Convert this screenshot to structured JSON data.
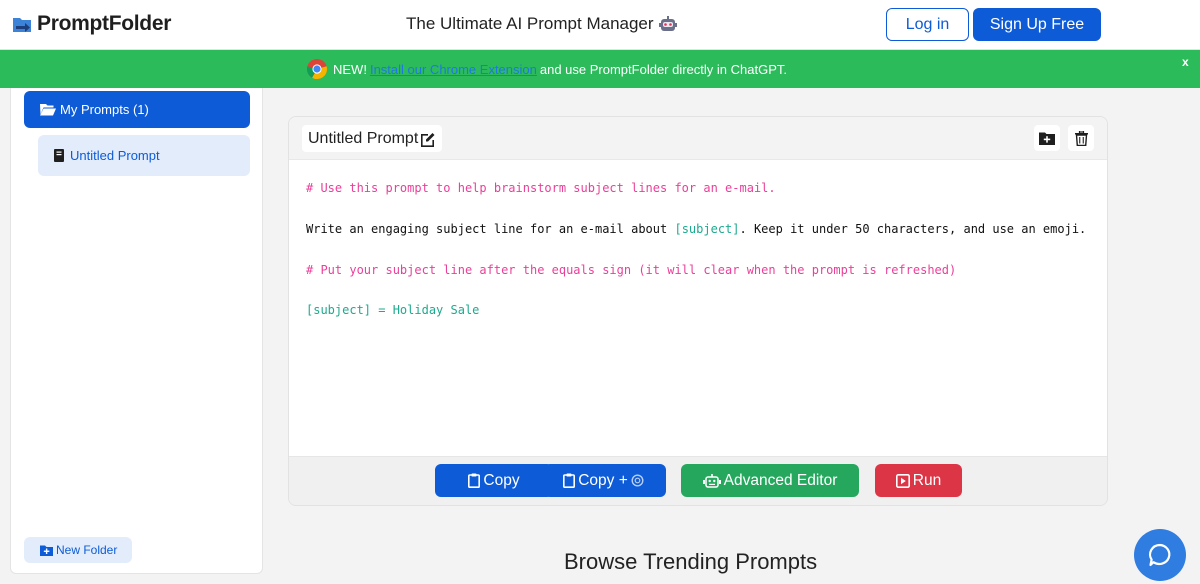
{
  "header": {
    "logo_text": "PromptFolder",
    "tagline": "The Ultimate AI Prompt Manager",
    "login_label": "Log in",
    "signup_label": "Sign Up Free"
  },
  "banner": {
    "new_label": "NEW!",
    "link_text": "Install our Chrome Extension",
    "rest_text": "and use PromptFolder directly in ChatGPT.",
    "close_label": "x"
  },
  "sidebar": {
    "folder_label": "My Prompts (1)",
    "prompt_label": "Untitled Prompt",
    "new_folder_label": "New Folder"
  },
  "prompt": {
    "title": "Untitled Prompt",
    "lines": {
      "l1": "# Use this prompt to help brainstorm subject lines for an e-mail.",
      "l2_a": "Write an engaging subject line for an e-mail about ",
      "l2_var": "[subject]",
      "l2_b": ". Keep it under 50 characters, and use an emoji.",
      "l3": "# Put your subject line after the equals sign (it will clear when the prompt is refreshed)",
      "l4": "[subject] = Holiday Sale"
    }
  },
  "footer_buttons": {
    "copy": "Copy",
    "copy_plus": "Copy +",
    "advanced": "Advanced Editor",
    "run": "Run"
  },
  "trending_heading": "Browse Trending Prompts",
  "colors": {
    "primary": "#0d5bd7",
    "banner_green": "#2cbb5b",
    "success": "#25a85e",
    "danger": "#dc3545",
    "comment": "#ea3f9a",
    "variable": "#1eaa8e"
  },
  "icons": {
    "logo": "arrow-folder-icon",
    "robot": "robot-icon",
    "chrome": "chrome-icon",
    "folder": "folder-open-icon",
    "prompt": "book-icon",
    "edit": "edit-icon",
    "move": "folder-plus-icon",
    "delete": "trash-icon",
    "clipboard": "clipboard-icon",
    "openai": "openai-icon",
    "robot_editor": "robot-icon",
    "run": "play-square-icon",
    "chat": "chat-icon"
  }
}
